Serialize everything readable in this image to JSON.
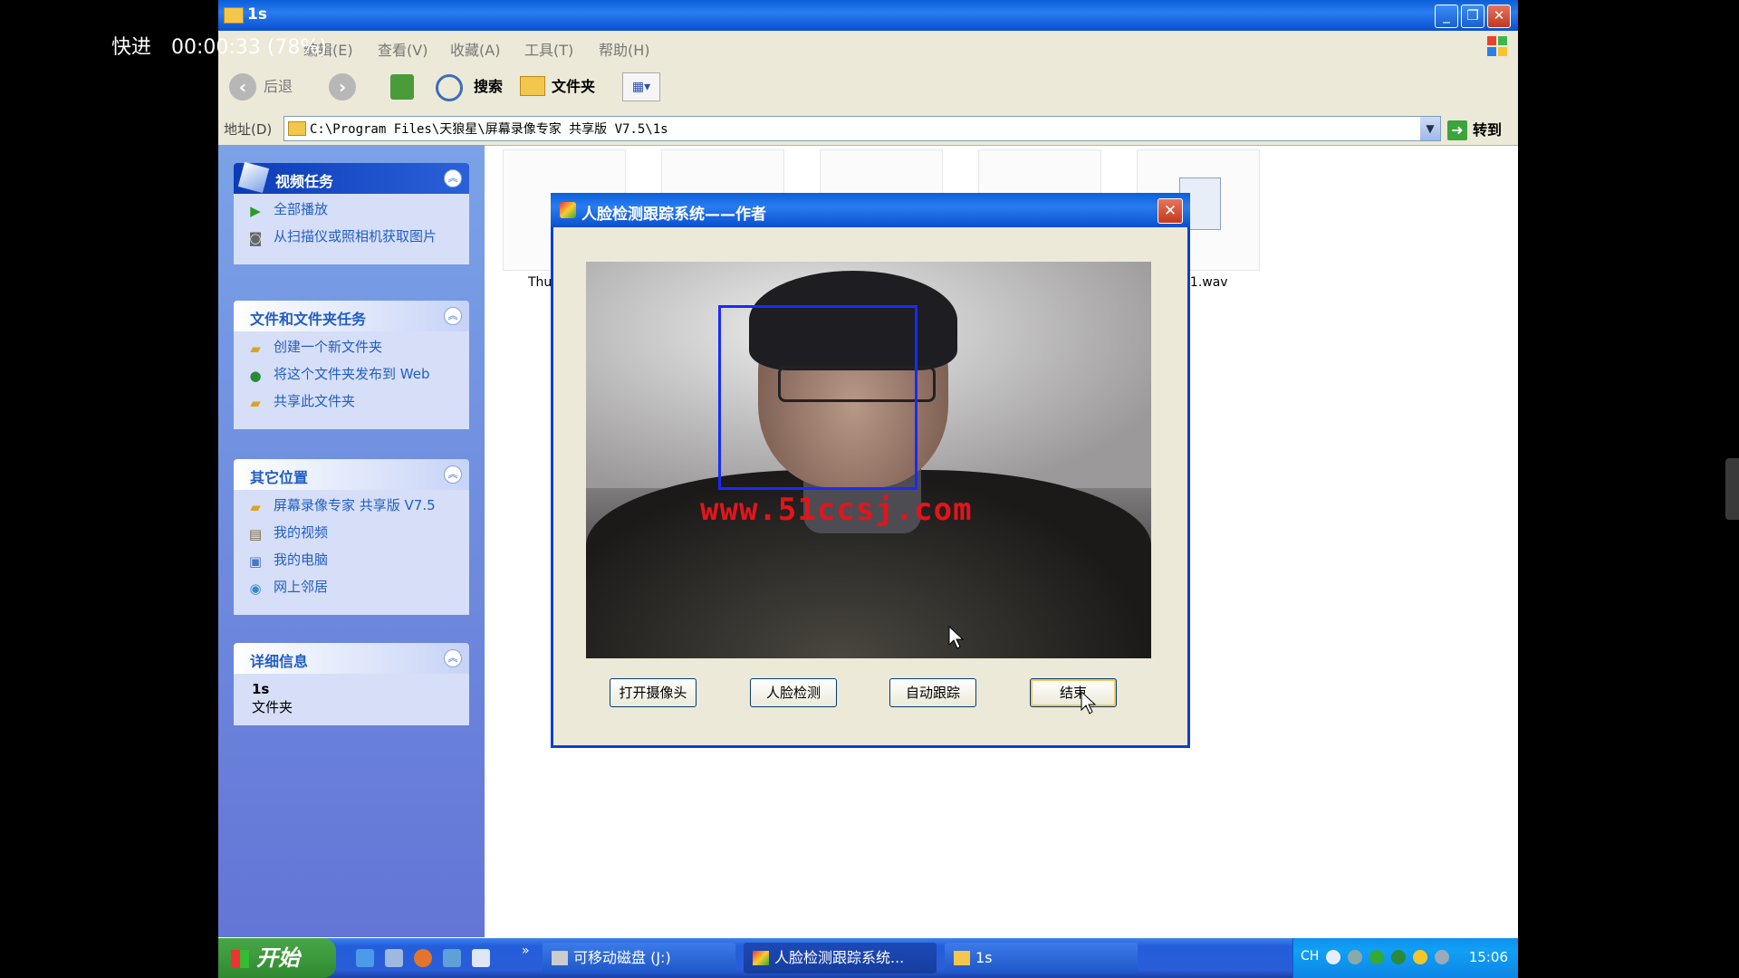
{
  "player": {
    "mode": "快进",
    "time": "00:00:33 (78%)"
  },
  "window": {
    "title": "1s"
  },
  "menu": {
    "items": [
      "编辑(E)",
      "查看(V)",
      "收藏(A)",
      "工具(T)",
      "帮助(H)"
    ]
  },
  "toolbar": {
    "back": "后退",
    "search": "搜索",
    "folders": "文件夹"
  },
  "address": {
    "label": "地址(D)",
    "path": "C:\\Program Files\\天狼星\\屏幕录像专家 共享版 V7.5\\1s",
    "go": "转到"
  },
  "taskpane": {
    "video_tasks": {
      "title": "视频任务",
      "items": [
        "全部播放",
        "从扫描仪或照相机获取图片"
      ]
    },
    "file_tasks": {
      "title": "文件和文件夹任务",
      "items": [
        "创建一个新文件夹",
        "将这个文件夹发布到 Web",
        "共享此文件夹"
      ]
    },
    "other_places": {
      "title": "其它位置",
      "items": [
        "屏幕录像专家 共享版 V7.5",
        "我的视频",
        "我的电脑",
        "网上邻居"
      ]
    },
    "details": {
      "title": "详细信息",
      "name": "1s",
      "type": "文件夹"
    }
  },
  "files": {
    "left_partial": "Thu",
    "right_partial": "11.wav"
  },
  "dialog": {
    "title": "人脸检测跟踪系统——作者",
    "watermark": "www.51ccsj.com",
    "buttons": [
      "打开摄像头",
      "人脸检测",
      "自动跟踪",
      "结束"
    ]
  },
  "taskbar": {
    "start": "开始",
    "tasks": [
      "可移动磁盘 (J:)",
      "人脸检测跟踪系统...",
      "1s"
    ],
    "lang": "CH",
    "clock": "15:06"
  }
}
